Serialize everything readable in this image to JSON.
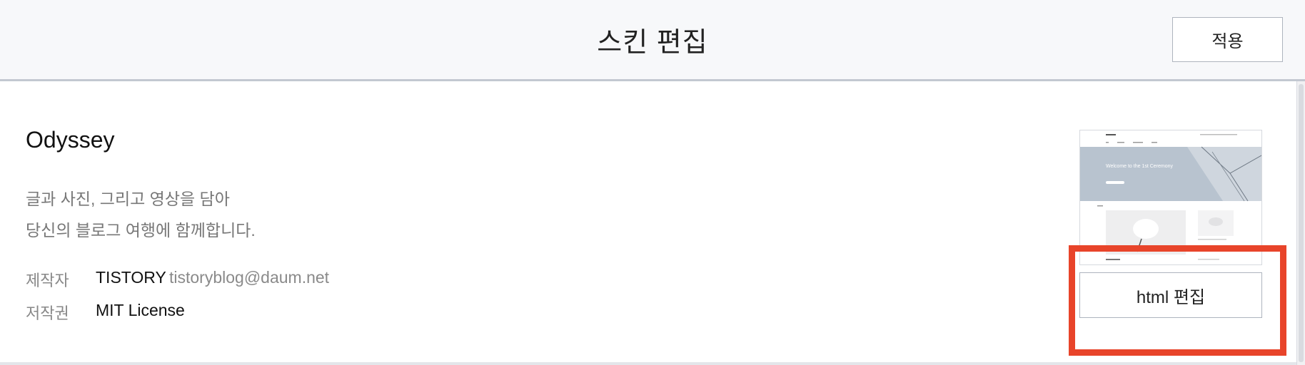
{
  "header": {
    "title": "스킨 편집",
    "apply_label": "적용"
  },
  "skin": {
    "name": "Odyssey",
    "description_line1": "글과 사진, 그리고 영상을 담아",
    "description_line2": "당신의 블로그 여행에 함께합니다.",
    "author_label": "제작자",
    "author_name": "TISTORY",
    "author_email": "tistoryblog@daum.net",
    "license_label": "저작권",
    "license_value": "MIT License",
    "html_edit_label": "html 편집",
    "preview_heading": "Welcome to the 1st Ceremony"
  },
  "colors": {
    "highlight": "#e8442a",
    "header_bg": "#f7f8fa"
  }
}
